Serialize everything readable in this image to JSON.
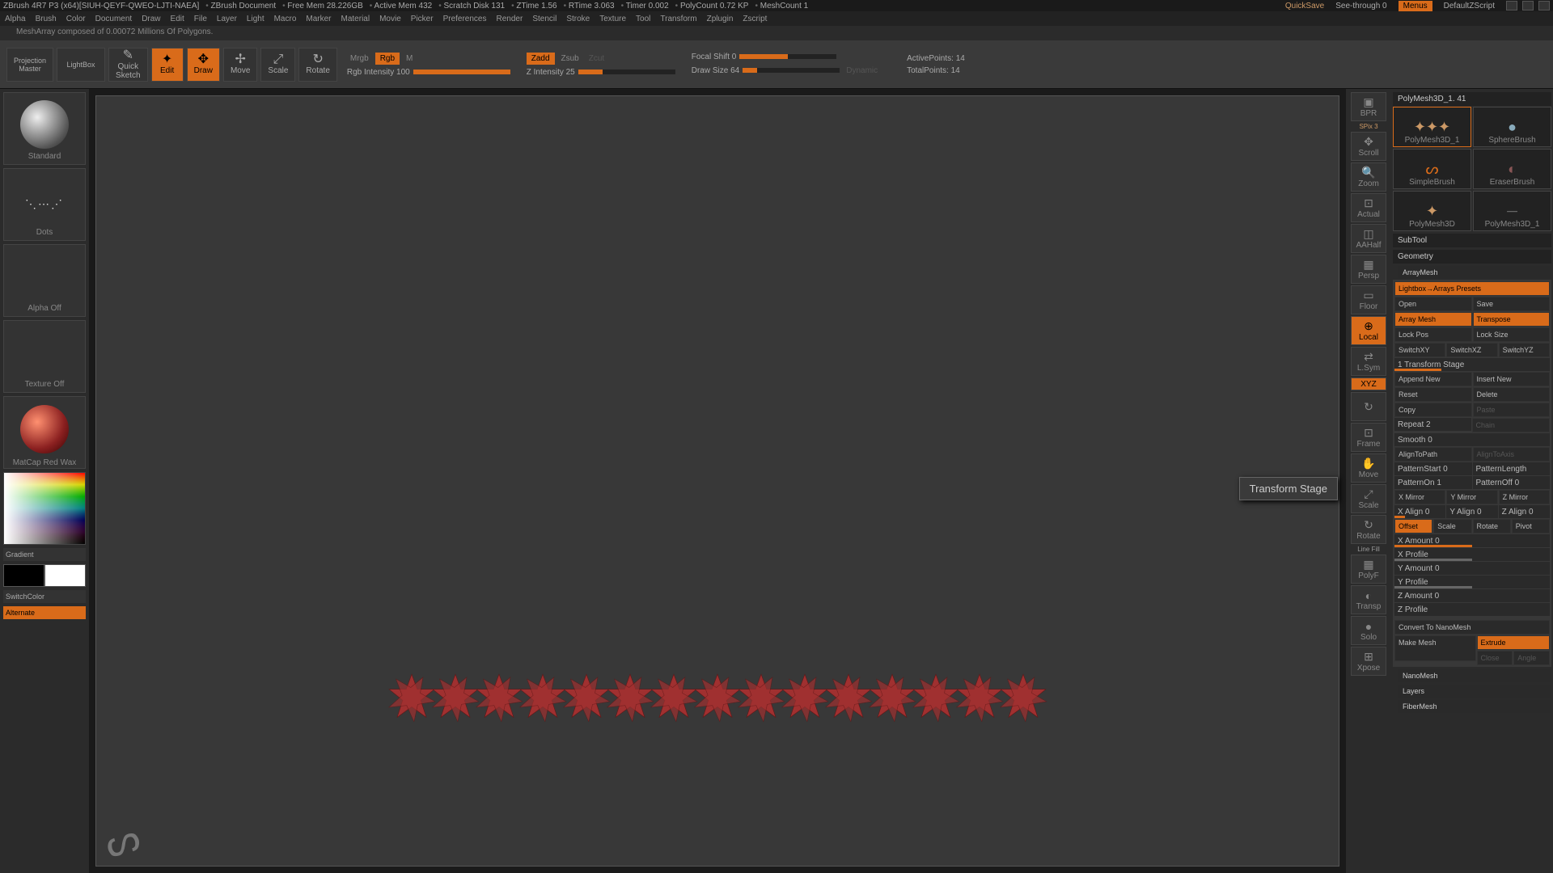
{
  "top": {
    "title": "ZBrush 4R7 P3 (x64)[SIUH-QEYF-QWEO-LJTI-NAEA]",
    "doc": "ZBrush Document",
    "mem": "Free Mem 28.226GB",
    "amem": "Active Mem 432",
    "scratch": "Scratch Disk 131",
    "ztime": "ZTime 1.56",
    "rtime": "RTime 3.063",
    "timer": "Timer 0.002",
    "poly": "PolyCount 0.72 KP",
    "mesh": "MeshCount 1",
    "quicksave": "QuickSave",
    "seethrough": "See-through 0",
    "menus": "Menus",
    "script": "DefaultZScript"
  },
  "menu": [
    "Alpha",
    "Brush",
    "Color",
    "Document",
    "Draw",
    "Edit",
    "File",
    "Layer",
    "Light",
    "Macro",
    "Marker",
    "Material",
    "Movie",
    "Picker",
    "Preferences",
    "Render",
    "Stencil",
    "Stroke",
    "Texture",
    "Tool",
    "Transform",
    "Zplugin",
    "Zscript"
  ],
  "status": "MeshArray composed of 0.00072 Millions Of Polygons.",
  "toolbar": {
    "proj": "Projection\nMaster",
    "lightbox": "LightBox",
    "quicksketch": "Quick\nSketch",
    "edit": "Edit",
    "draw": "Draw",
    "move": "Move",
    "scale": "Scale",
    "rotate": "Rotate",
    "mrgb": "Mrgb",
    "rgb": "Rgb",
    "m": "M",
    "rgbint": "Rgb Intensity 100",
    "zadd": "Zadd",
    "zsub": "Zsub",
    "zcut": "Zcut",
    "zint": "Z Intensity 25",
    "focal": "Focal Shift 0",
    "drawsize": "Draw Size 64",
    "dynamic": "Dynamic",
    "active": "ActivePoints: 14",
    "total": "TotalPoints: 14"
  },
  "left": {
    "brush": "Standard",
    "stroke": "Dots",
    "alpha": "Alpha Off",
    "texture": "Texture Off",
    "material": "MatCap Red Wax",
    "gradient": "Gradient",
    "switchcolor": "SwitchColor",
    "alternate": "Alternate"
  },
  "ricons": [
    "BPR",
    "SPix 3",
    "Scroll",
    "Zoom",
    "Actual",
    "AAHalf",
    "Persp",
    "Floor",
    "Local",
    "L.Sym",
    "XYZ",
    "",
    "Frame",
    "Move",
    "Scale",
    "Rotate",
    "PolyF",
    "Transp",
    "Solo",
    "Xpose"
  ],
  "tool_header": "PolyMesh3D_1. 41",
  "brushes": [
    "PolyMesh3D_1",
    "SphereBrush",
    "SimpleBrush",
    "EraserBrush",
    "PolyMesh3D",
    "PolyMesh3D_1"
  ],
  "sections": {
    "subtool": "SubTool",
    "geometry": "Geometry",
    "arraymesh": "ArrayMesh",
    "nanomesh": "NanoMesh",
    "layers": "Layers",
    "fibermesh": "FiberMesh"
  },
  "array": {
    "lightbox_presets": "Lightbox→Arrays Presets",
    "open": "Open",
    "save": "Save",
    "arraymesh": "Array Mesh",
    "transpose": "Transpose",
    "lockpos": "Lock Pos",
    "locksize": "Lock Size",
    "sxy": "SwitchXY",
    "sxz": "SwitchXZ",
    "syz": "SwitchYZ",
    "tstage": "1 Transform Stage",
    "append": "Append New",
    "insert": "Insert New",
    "reset": "Reset",
    "delete": "Delete",
    "copy": "Copy",
    "paste": "Paste",
    "repeat": "Repeat 2",
    "chain": "Chain",
    "smooth": "Smooth 0",
    "aligntopath": "AlignToPath",
    "aligntoaxis": "AlignToAxis",
    "pstart": "PatternStart 0",
    "plength": "PatternLength",
    "pon": "PatternOn 1",
    "poff": "PatternOff 0",
    "xmirror": "X Mirror",
    "ymirror": "Y Mirror",
    "zmirror": "Z Mirror",
    "xalign": "X Align 0",
    "yalign": "Y Align 0",
    "zalign": "Z Align 0",
    "offset": "Offset",
    "scale": "Scale",
    "rotate": "Rotate",
    "pivot": "Pivot",
    "xamt": "X Amount 0",
    "xprof": "X Profile",
    "yamt": "Y Amount 0",
    "yprof": "Y Profile",
    "zamt": "Z Amount 0",
    "zprof": "Z Profile",
    "convert": "Convert To NanoMesh",
    "makemesh": "Make Mesh",
    "extrude": "Extrude",
    "close": "Close",
    "angle": "Angle"
  },
  "linefill": "Line Fill",
  "tooltip": "Transform Stage"
}
